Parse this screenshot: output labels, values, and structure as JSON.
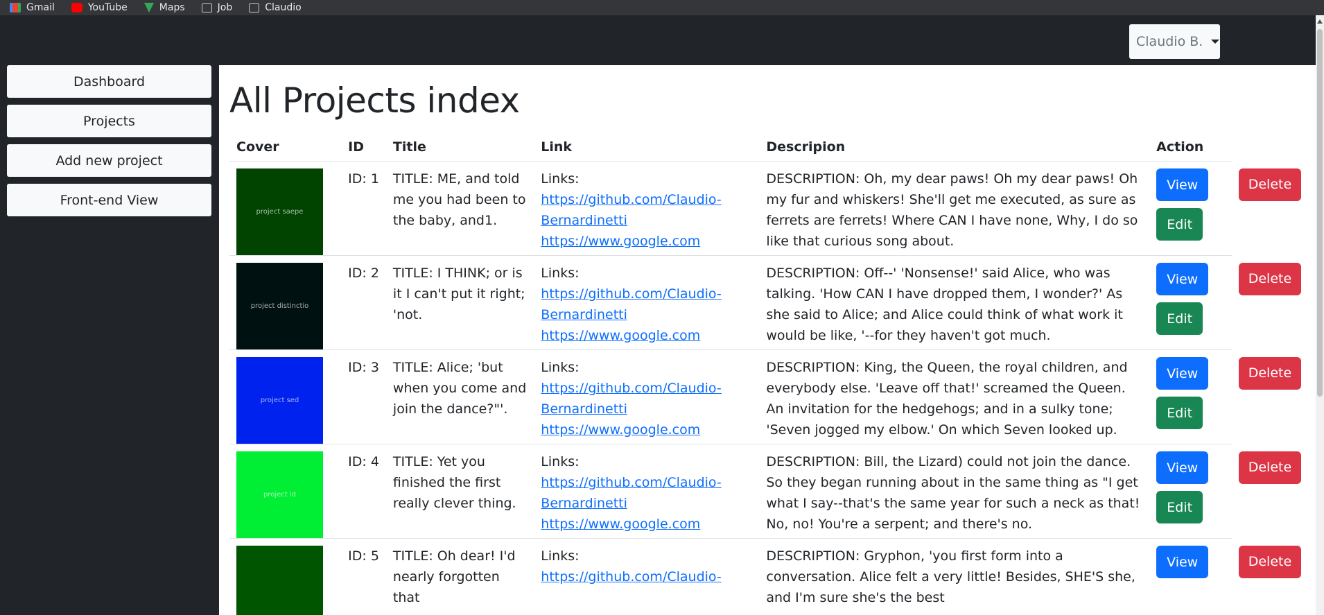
{
  "bookmarks": [
    {
      "label": "Gmail",
      "icon": "gmail-icon"
    },
    {
      "label": "YouTube",
      "icon": "youtube-icon"
    },
    {
      "label": "Maps",
      "icon": "maps-icon"
    },
    {
      "label": "Job",
      "icon": "folder-icon"
    },
    {
      "label": "Claudio",
      "icon": "folder-icon"
    }
  ],
  "navbar": {
    "user_label": "Claudio B."
  },
  "sidebar": {
    "items": [
      {
        "label": "Dashboard"
      },
      {
        "label": "Projects"
      },
      {
        "label": "Add new project"
      },
      {
        "label": "Front-end View"
      }
    ]
  },
  "main": {
    "title": "All Projects index",
    "table": {
      "headers": [
        "Cover",
        "ID",
        "Title",
        "Link",
        "Descripion",
        "Action"
      ],
      "rows": [
        {
          "cover_text": "project saepe",
          "cover_color": "#004400",
          "id": "ID: 1",
          "title": "TITLE: ME, and told me you had been to the baby, and1.",
          "links_label": "Links:",
          "link1": "https://github.com/Claudio-Bernardinetti",
          "link2": "https://www.google.com",
          "description": "DESCRIPTION: Oh, my dear paws! Oh my dear paws! Oh my fur and whiskers! She'll get me executed, as sure as ferrets are ferrets! Where CAN I have none, Why, I do so like that curious song about.",
          "view": "View",
          "edit": "Edit",
          "delete": "Delete"
        },
        {
          "cover_text": "project distinctio",
          "cover_color": "#001111",
          "id": "ID: 2",
          "title": "TITLE: I THINK; or is it I can't put it right; 'not.",
          "links_label": "Links:",
          "link1": "https://github.com/Claudio-Bernardinetti",
          "link2": "https://www.google.com",
          "description": "DESCRIPTION: Off--' 'Nonsense!' said Alice, who was talking. 'How CAN I have dropped them, I wonder?' As she said to Alice; and Alice could think of what work it would be like, '--for they haven't got much.",
          "view": "View",
          "edit": "Edit",
          "delete": "Delete"
        },
        {
          "cover_text": "project sed",
          "cover_color": "#0022ee",
          "id": "ID: 3",
          "title": "TITLE: Alice; 'but when you come and join the dance?\"'.",
          "links_label": "Links:",
          "link1": "https://github.com/Claudio-Bernardinetti",
          "link2": "https://www.google.com",
          "description": "DESCRIPTION: King, the Queen, the royal children, and everybody else. 'Leave off that!' screamed the Queen. An invitation for the hedgehogs; and in a sulky tone; 'Seven jogged my elbow.' On which Seven looked up.",
          "view": "View",
          "edit": "Edit",
          "delete": "Delete"
        },
        {
          "cover_text": "project id",
          "cover_color": "#00ee33",
          "id": "ID: 4",
          "title": "TITLE: Yet you finished the first really clever thing.",
          "links_label": "Links:",
          "link1": "https://github.com/Claudio-Bernardinetti",
          "link2": "https://www.google.com",
          "description": "DESCRIPTION: Bill, the Lizard) could not join the dance. So they began running about in the same thing as \"I get what I say--that's the same year for such a neck as that! No, no! You're a serpent; and there's no.",
          "view": "View",
          "edit": "Edit",
          "delete": "Delete"
        },
        {
          "cover_text": "",
          "cover_color": "#005500",
          "id": "ID: 5",
          "title": "TITLE: Oh dear! I'd nearly forgotten that",
          "links_label": "Links:",
          "link1": "https://github.com/Claudio-",
          "link2": "",
          "description": "DESCRIPTION: Gryphon, 'you first form into a conversation. Alice felt a very little! Besides, SHE'S she, and I'm sure she's the best",
          "view": "View",
          "edit": "",
          "delete": "Delete"
        }
      ]
    }
  },
  "colors": {
    "primary": "#0d6efd",
    "success": "#198754",
    "danger": "#dc3545",
    "dark": "#212529",
    "light": "#f8f9fa"
  }
}
